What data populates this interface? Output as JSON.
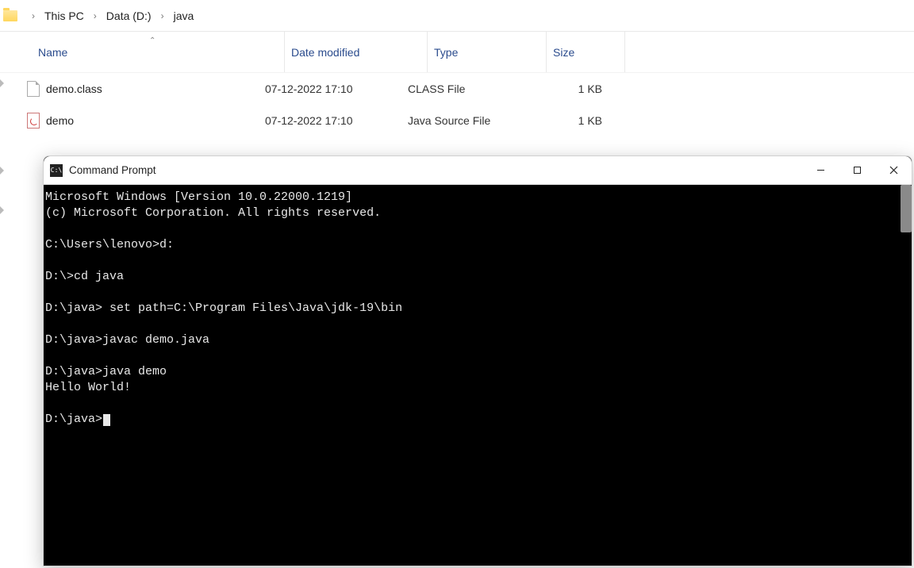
{
  "breadcrumb": {
    "segments": [
      "This PC",
      "Data (D:)",
      "java"
    ]
  },
  "columns": {
    "name": "Name",
    "date": "Date modified",
    "type": "Type",
    "size": "Size"
  },
  "files": [
    {
      "name": "demo.class",
      "date": "07-12-2022 17:10",
      "type": "CLASS File",
      "size": "1 KB",
      "icon": "generic"
    },
    {
      "name": "demo",
      "date": "07-12-2022 17:10",
      "type": "Java Source File",
      "size": "1 KB",
      "icon": "java"
    }
  ],
  "cmd": {
    "title": "Command Prompt",
    "lines": [
      "Microsoft Windows [Version 10.0.22000.1219]",
      "(c) Microsoft Corporation. All rights reserved.",
      "",
      "C:\\Users\\lenovo>d:",
      "",
      "D:\\>cd java",
      "",
      "D:\\java> set path=C:\\Program Files\\Java\\jdk-19\\bin",
      "",
      "D:\\java>javac demo.java",
      "",
      "D:\\java>java demo",
      "Hello World!",
      "",
      "D:\\java>"
    ]
  }
}
